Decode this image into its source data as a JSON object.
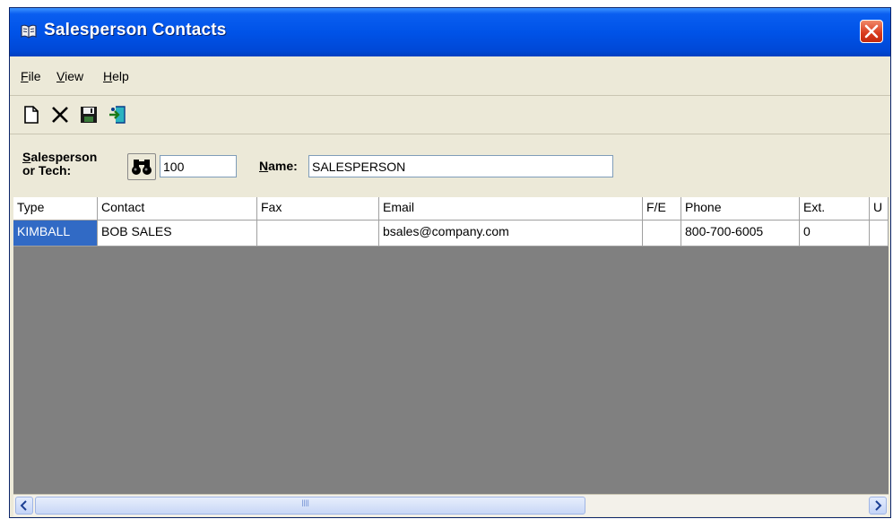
{
  "window": {
    "title": "Salesperson Contacts",
    "title_icon": "book-icon",
    "close_icon": "close-icon",
    "accent_color": "#0053e8",
    "close_color": "#d8391c"
  },
  "menu": {
    "items": [
      {
        "label": "File",
        "accel": "F",
        "rest": "ile"
      },
      {
        "label": "View",
        "accel": "V",
        "rest": "iew"
      },
      {
        "label": "Help",
        "accel": "H",
        "rest": "elp"
      }
    ]
  },
  "toolbar": {
    "icons": [
      "new-document-icon",
      "delete-icon",
      "save-icon",
      "exit-icon"
    ]
  },
  "form": {
    "salesperson_label_accel": "S",
    "salesperson_label_rest": "alesperson",
    "salesperson_label_line2": "or Tech:",
    "lookup_icon": "binoculars-icon",
    "salesperson_value": "100",
    "name_label_accel": "N",
    "name_label_rest": "ame:",
    "name_value": "SALESPERSON"
  },
  "table": {
    "columns": [
      "Type",
      "Contact",
      "Fax",
      "Email",
      "F/E",
      "Phone",
      "Ext.",
      "U"
    ],
    "rows": [
      [
        "KIMBALL",
        "BOB SALES",
        "",
        "bsales@company.com",
        "",
        "800-700-6005",
        "0",
        ""
      ]
    ],
    "selected_color": "#316ac5",
    "empty_area_color": "#808080"
  },
  "scrollbar": {
    "thumb_grip": "IIII"
  }
}
